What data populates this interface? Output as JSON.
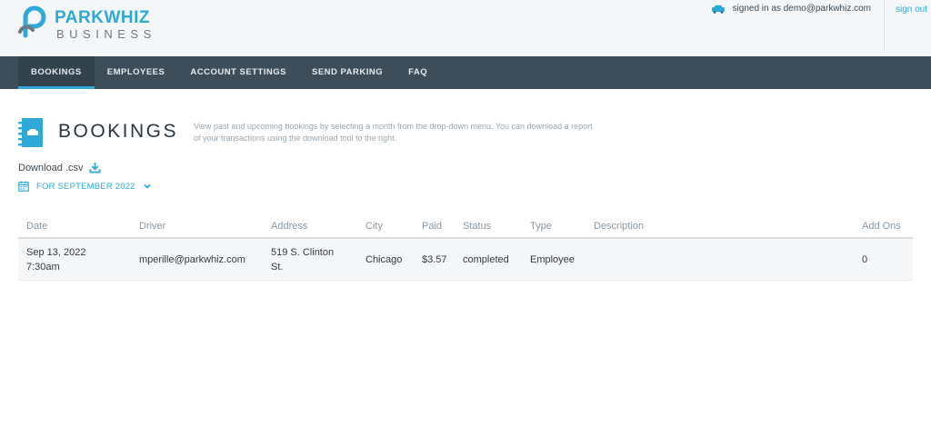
{
  "header": {
    "brand_top_a": "PARK",
    "brand_top_b": "WHIZ",
    "brand_bottom": "BUSINESS",
    "signed_in_text": "signed in as demo@parkwhiz.com",
    "signout_label": "sign out"
  },
  "nav": {
    "items": [
      {
        "label": "BOOKINGS",
        "active": true
      },
      {
        "label": "EMPLOYEES",
        "active": false
      },
      {
        "label": "ACCOUNT SETTINGS",
        "active": false
      },
      {
        "label": "SEND PARKING",
        "active": false
      },
      {
        "label": "FAQ",
        "active": false
      }
    ]
  },
  "page": {
    "title": "BOOKINGS",
    "description": "View past and upcoming bookings by selecting a month from the drop-down menu. You can download a report of your transactions using the download tool to the right.",
    "download_label": "Download .csv",
    "month_label": "FOR SEPTEMBER 2022"
  },
  "table": {
    "columns": [
      "Date",
      "Driver",
      "Address",
      "City",
      "Paid",
      "Status",
      "Type",
      "Description",
      "Add Ons"
    ],
    "rows": [
      {
        "date_line1": "Sep 13, 2022",
        "date_line2": "7:30am",
        "driver": "mperille@parkwhiz.com",
        "address_line1": "519 S. Clinton",
        "address_line2": "St.",
        "city": "Chicago",
        "paid": "$3.57",
        "status": "completed",
        "type": "Employee",
        "description": "",
        "add_ons": "0"
      }
    ]
  },
  "colors": {
    "accent": "#2fa9d8",
    "nav_bg": "#3d4e5a",
    "header_bg": "#f4f6f8"
  },
  "icons": [
    "parkwhiz-logo-icon",
    "car-icon",
    "bookings-book-icon",
    "download-icon",
    "calendar-icon",
    "chevron-down-icon"
  ]
}
